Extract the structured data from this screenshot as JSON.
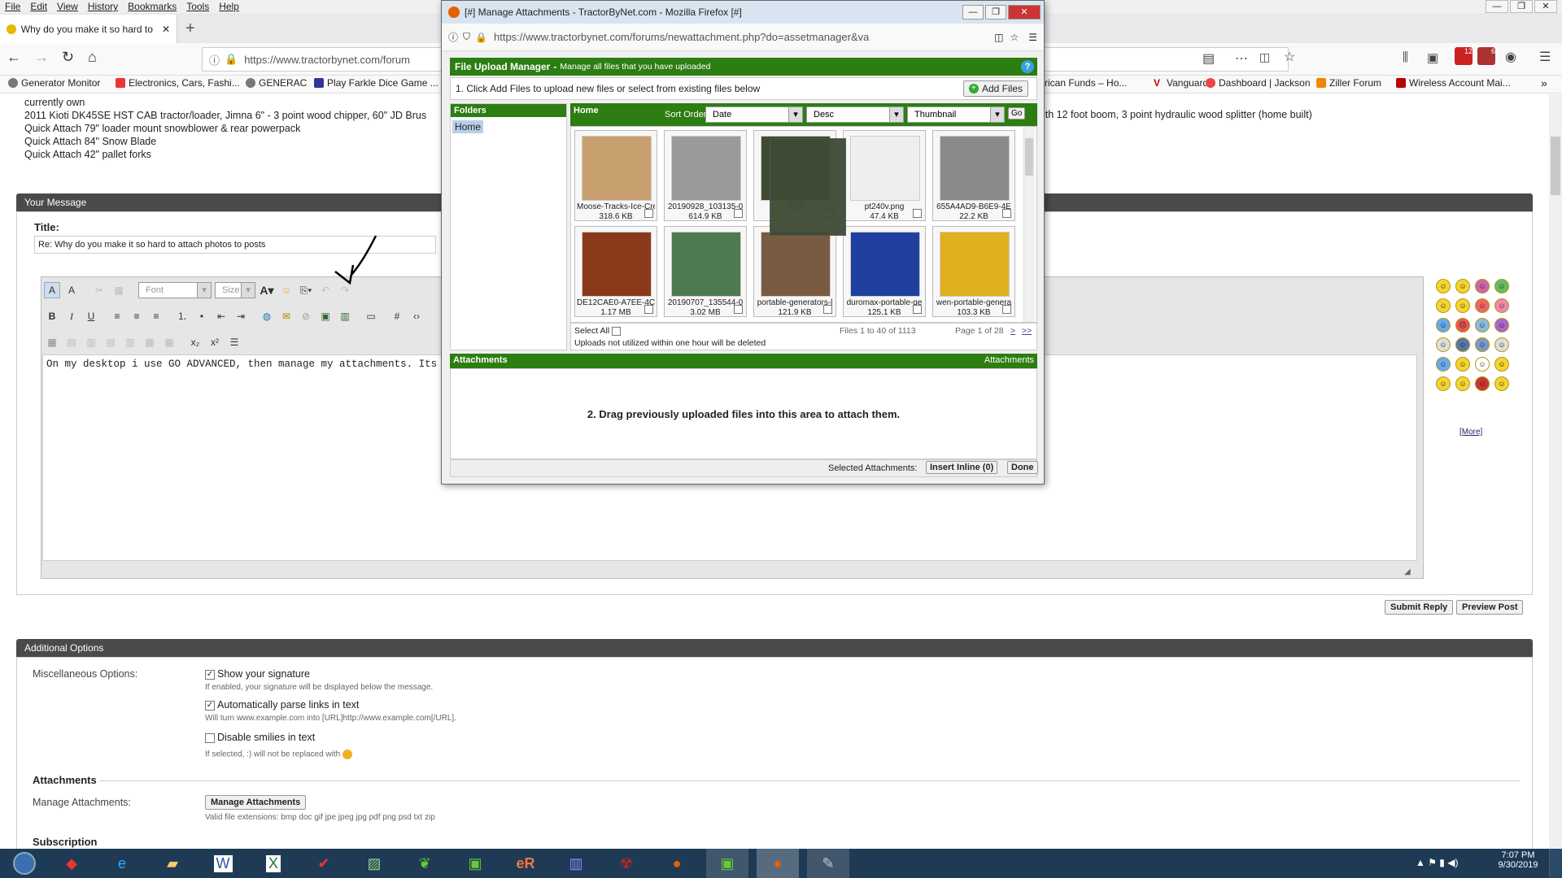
{
  "menu": [
    "File",
    "Edit",
    "View",
    "History",
    "Bookmarks",
    "Tools",
    "Help"
  ],
  "tab": {
    "title": "Why do you make it so hard to"
  },
  "url": "https://www.tractorbynet.com/forum",
  "bookmarks": [
    "Generator Monitor",
    "Electronics, Cars, Fashi...",
    "GENERAC",
    "Play Farkle Dice Game ...",
    "rican Funds – Ho...",
    "Vanguard",
    "Dashboard | Jackson",
    "Ziller Forum",
    "Wireless Account Mai..."
  ],
  "toolbar_badges": {
    "a": "12",
    "b": "6"
  },
  "signature": {
    "line1": "currently own",
    "line2": "2011 Kioti DK45SE HST CAB tractor/loader, Jimna 6\" - 3 point wood chipper, 60\" JD Brus",
    "line2b": "ith 12 foot boom, 3 point hydraulic wood splitter (home built)",
    "line3": "Quick Attach 79\" loader mount snowblower & rear powerpack",
    "line4": "Quick Attach 84\" Snow Blade",
    "line5": "Quick Attach 42\" pallet forks"
  },
  "your_message": {
    "header": "Your Message",
    "title_label": "Title:",
    "title_value": "Re: Why do you make it so hard to attach photos to posts",
    "font_placeholder": "Font",
    "size_placeholder": "Size",
    "body": "On my desktop i use GO ADVANCED, then manage my attachments. Its ea",
    "more": "[More]"
  },
  "buttons": {
    "submit": "Submit Reply",
    "preview": "Preview Post"
  },
  "additional": {
    "header": "Additional Options",
    "misc_label": "Miscellaneous Options:",
    "sig_label": "Show your signature",
    "sig_help": "If enabled, your signature will be displayed below the message.",
    "links_label": "Automatically parse links in text",
    "links_help": "Will turn www.example.com into [URL]http://www.example.com[/URL].",
    "smilies_label": "Disable smilies in text",
    "smilies_help": "If selected, :) will not be replaced with",
    "attachments_title": "Attachments",
    "manage_label": "Manage Attachments:",
    "manage_button": "Manage Attachments",
    "valid_ext": "Valid file extensions: bmp doc gif jpe jpeg jpg pdf png psd txt zip",
    "subscription": "Subscription"
  },
  "popup": {
    "window_title": "[#] Manage Attachments - TractorByNet.com - Mozilla Firefox [#]",
    "url": "https://www.tractorbynet.com/forums/newattachment.php?do=assetmanager&va",
    "header_title": "File Upload Manager",
    "header_sub": "Manage all files that you have uploaded",
    "step1": "1. Click Add Files to upload new files or select from existing files below",
    "add_files": "Add Files",
    "folders": "Folders",
    "home_folder": "Home",
    "home": "Home",
    "sort_order": "Sort Order:",
    "sort_by": "Date",
    "sort_dir": "Desc",
    "view": "Thumbnail",
    "go": "Go",
    "select_all": "Select All",
    "files_count": "Files 1 to 40 of 1113",
    "page_of": "Page 1 of 28",
    "next": ">",
    "last": ">>",
    "notice": "Uploads not utilized within one hour will be deleted",
    "attachments": "Attachments",
    "attachments_right": "Attachments",
    "drag_text": "2. Drag previously uploaded files into this area to attach them.",
    "selected_label": "Selected Attachments:",
    "insert_inline": "Insert Inline (0)",
    "done": "Done",
    "files": [
      {
        "name": "Moose-Tracks-Ice-Cre",
        "size": "318.6 KB",
        "color": "#c8a070"
      },
      {
        "name": "20190928_103135-0",
        "size": "614.9 KB",
        "color": "#9a9a9a"
      },
      {
        "name": "2019",
        "size": "",
        "color": "#3e4a34"
      },
      {
        "name": "pt240v.png",
        "size": "47.4 KB",
        "color": "#eeeeee"
      },
      {
        "name": "655A4AD9-B6E9-4E",
        "size": "22.2 KB",
        "color": "#8a8a8a"
      },
      {
        "name": "DE12CAE0-A7EE-4C",
        "size": "1.17 MB",
        "color": "#8a3a1a"
      },
      {
        "name": "20190707_135544-0",
        "size": "3.02 MB",
        "color": "#4d7a50"
      },
      {
        "name": "portable-generators-l",
        "size": "121.9 KB",
        "color": "#7a5a40"
      },
      {
        "name": "duromax-portable-ge",
        "size": "125.1 KB",
        "color": "#2040a0"
      },
      {
        "name": "wen-portable-genera",
        "size": "103.3 KB",
        "color": "#e0b020"
      }
    ]
  },
  "taskbar": {
    "time": "7:07 PM",
    "date": "9/30/2019"
  }
}
